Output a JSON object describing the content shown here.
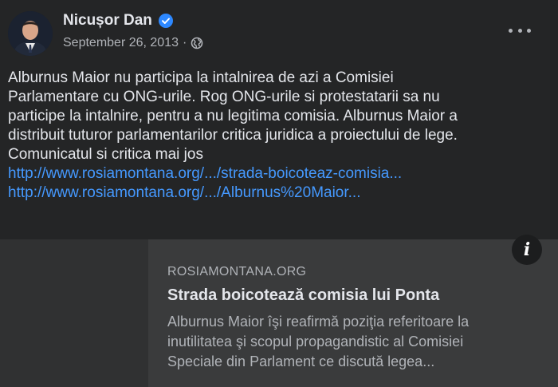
{
  "post": {
    "author": "Nicușor Dan",
    "date": "September 26, 2013",
    "separator": "·",
    "audience_icon": "globe-icon",
    "verified_icon": "verified-badge-icon",
    "more_icon": "more-options-icon",
    "text_lines": [
      "Alburnus Maior nu participa la intalnirea de azi a Comisiei",
      "Parlamentare cu ONG-urile. Rog ONG-urile si protestatarii sa nu",
      "participe la intalnire, pentru a nu legitima comisia. Alburnus Maior a",
      "distribuit tuturor parlamentarilor critica juridica a proiectului de lege.",
      "Comunicatul si critica mai jos"
    ],
    "links": [
      "http://www.rosiamontana.org/.../strada-boicoteaz-comisia...",
      "http://www.rosiamontana.org/.../Alburnus%20Maior..."
    ]
  },
  "link_preview": {
    "domain": "ROSIAMONTANA.ORG",
    "title": "Strada boicotează comisia lui Ponta",
    "description_lines": [
      "Alburnus Maior îşi reafirmă poziţia referitoare la",
      "inutilitatea şi scopul propagandistic al Comisiei",
      "Speciale din Parlament ce discută legea..."
    ],
    "info_label": "i"
  },
  "colors": {
    "background": "#242526",
    "text": "#e4e6eb",
    "secondary_text": "#b0b3b8",
    "link": "#4599ff",
    "verified": "#2d88ff",
    "preview_bg": "#3a3b3c"
  }
}
